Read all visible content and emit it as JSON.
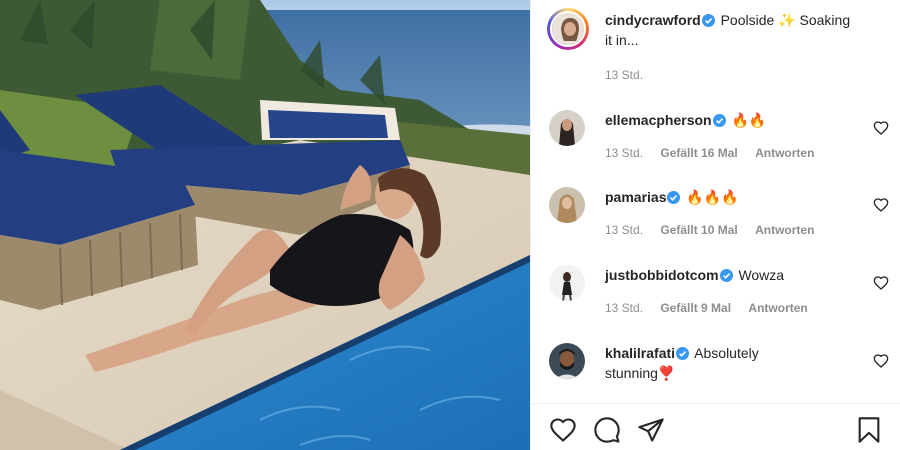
{
  "caption": {
    "username": "cindycrawford",
    "text_line1": "Poolside ✨ Soaking",
    "text_line2": "it in...",
    "time": "13 Std."
  },
  "comments": [
    {
      "username": "ellemacpherson",
      "text": "🔥🔥",
      "time": "13 Std.",
      "likes": "Gefällt 16 Mal",
      "reply": "Antworten"
    },
    {
      "username": "pamarias",
      "text": "🔥🔥🔥",
      "time": "13 Std.",
      "likes": "Gefällt 10 Mal",
      "reply": "Antworten"
    },
    {
      "username": "justbobbidotcom",
      "text": "Wowza",
      "time": "13 Std.",
      "likes": "Gefällt 9 Mal",
      "reply": "Antworten"
    },
    {
      "username": "khalilrafati",
      "text": "Absolutely",
      "text_line2": "stunning❣️"
    }
  ],
  "icons": {
    "verified": "verified-badge-icon",
    "like": "heart-icon",
    "comment": "comment-bubble-icon",
    "share": "paper-plane-icon",
    "save": "bookmark-icon"
  },
  "colors": {
    "verified_blue": "#3897f0",
    "meta_gray": "#8e8e8e",
    "pool_blue": "#2f86c9",
    "cushion_navy": "#1f3a78"
  }
}
